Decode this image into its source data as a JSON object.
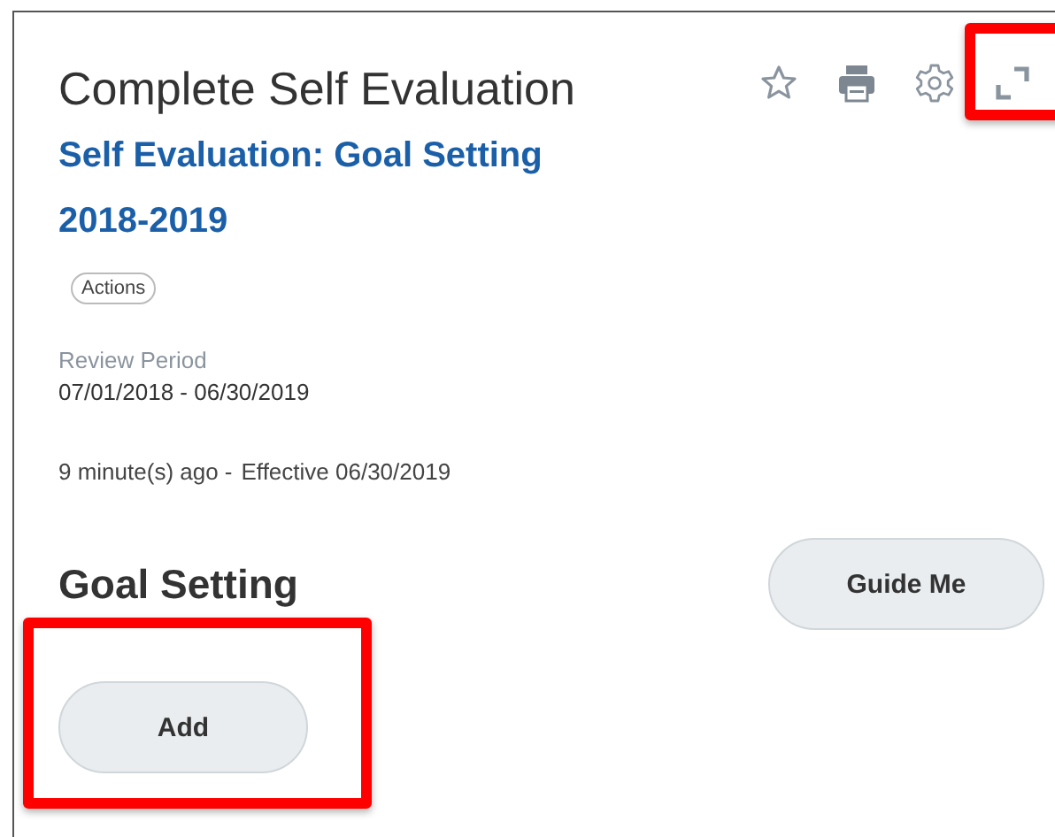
{
  "header": {
    "title": "Complete Self Evaluation",
    "subtitle": "Self Evaluation: Goal Setting 2018-2019"
  },
  "actions_label": "Actions",
  "review_period": {
    "label": "Review Period",
    "value": "07/01/2018 - 06/30/2019"
  },
  "timestamp": {
    "ago": "9 minute(s) ago -",
    "effective": "Effective 06/30/2019"
  },
  "section": {
    "title": "Goal Setting",
    "guide_button": "Guide Me",
    "add_button": "Add"
  }
}
